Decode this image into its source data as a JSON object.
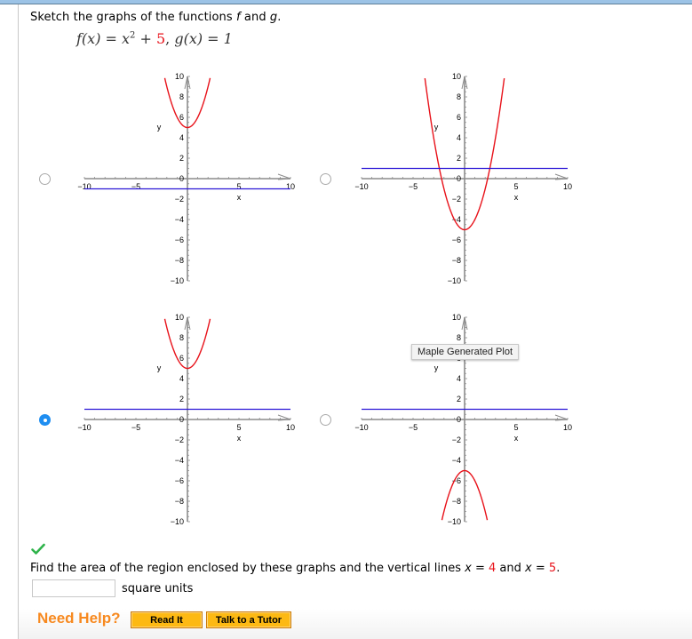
{
  "question": {
    "prompt_prefix": "Sketch the graphs of the functions ",
    "f_name": "f",
    "and_word": " and ",
    "g_name": "g",
    "period": ".",
    "formula": {
      "f_lhs": "f(x) = x",
      "exponent": "2",
      "plus": " + ",
      "constant": "5",
      "separator": ", ",
      "g_part": "g(x) = 1"
    }
  },
  "options": [
    {
      "id": "a",
      "selected": false
    },
    {
      "id": "b",
      "selected": false
    },
    {
      "id": "c",
      "selected": true
    },
    {
      "id": "d",
      "selected": false
    }
  ],
  "tooltip": "Maple Generated Plot",
  "status": {
    "icon": "checkmark-icon",
    "correct": true,
    "color": "#2eb34a"
  },
  "followup": {
    "text_prefix": "Find the area of the region enclosed by these graphs and the vertical lines ",
    "x1_var": "x",
    "eq1": " = ",
    "x1_value": "4",
    "and_word": " and ",
    "x2_var": "x",
    "eq2": " = ",
    "x2_value": "5",
    "period": ".",
    "answer_value": "",
    "answer_placeholder": "",
    "units": "square units"
  },
  "help": {
    "label": "Need Help?",
    "read_it": "Read It",
    "talk_to_tutor": "Talk to a Tutor"
  },
  "colors": {
    "f_curve": "#e8121a",
    "g_line": "#2a16d6",
    "axis": "#8c8c8c",
    "accent_orange": "#f7891f",
    "button_fill": "#fdb913",
    "radio_selected": "#1f8ef1"
  },
  "chart_data": [
    {
      "type": "line",
      "option": "a",
      "xlabel": "x",
      "ylabel": "y",
      "xlim": [
        -10,
        10
      ],
      "ylim": [
        -10,
        10
      ],
      "x_ticks": [
        -10,
        -5,
        5,
        10
      ],
      "y_ticks": [
        -10,
        -8,
        -6,
        -4,
        -2,
        0,
        2,
        4,
        6,
        8,
        10
      ],
      "series": [
        {
          "name": "f",
          "expr": "x^2 + 5",
          "a": 1,
          "c": 5,
          "color": "red"
        },
        {
          "name": "g",
          "expr": "-1",
          "constant": -1,
          "color": "blue"
        }
      ]
    },
    {
      "type": "line",
      "option": "b",
      "xlabel": "x",
      "ylabel": "y",
      "xlim": [
        -10,
        10
      ],
      "ylim": [
        -10,
        10
      ],
      "x_ticks": [
        -10,
        -5,
        5,
        10
      ],
      "y_ticks": [
        -10,
        -8,
        -6,
        -4,
        -2,
        0,
        2,
        4,
        6,
        8,
        10
      ],
      "series": [
        {
          "name": "f",
          "expr": "x^2 - 5",
          "a": 1,
          "c": -5,
          "color": "red"
        },
        {
          "name": "g",
          "expr": "1",
          "constant": 1,
          "color": "blue"
        }
      ]
    },
    {
      "type": "line",
      "option": "c",
      "xlabel": "x",
      "ylabel": "y",
      "xlim": [
        -10,
        10
      ],
      "ylim": [
        -10,
        10
      ],
      "x_ticks": [
        -10,
        -5,
        5,
        10
      ],
      "y_ticks": [
        -10,
        -8,
        -6,
        -4,
        -2,
        0,
        2,
        4,
        6,
        8,
        10
      ],
      "series": [
        {
          "name": "f",
          "expr": "x^2 + 5",
          "a": 1,
          "c": 5,
          "color": "red"
        },
        {
          "name": "g",
          "expr": "1",
          "constant": 1,
          "color": "blue"
        }
      ]
    },
    {
      "type": "line",
      "option": "d",
      "xlabel": "x",
      "ylabel": "y",
      "xlim": [
        -10,
        10
      ],
      "ylim": [
        -10,
        10
      ],
      "x_ticks": [
        -10,
        -5,
        5,
        10
      ],
      "y_ticks": [
        -10,
        -8,
        -6,
        -4,
        -2,
        0,
        2,
        4,
        6,
        8,
        10
      ],
      "series": [
        {
          "name": "f",
          "expr": "-x^2 - 5",
          "a": -1,
          "c": -5,
          "color": "red"
        },
        {
          "name": "g",
          "expr": "1",
          "constant": 1,
          "color": "blue"
        }
      ]
    }
  ]
}
